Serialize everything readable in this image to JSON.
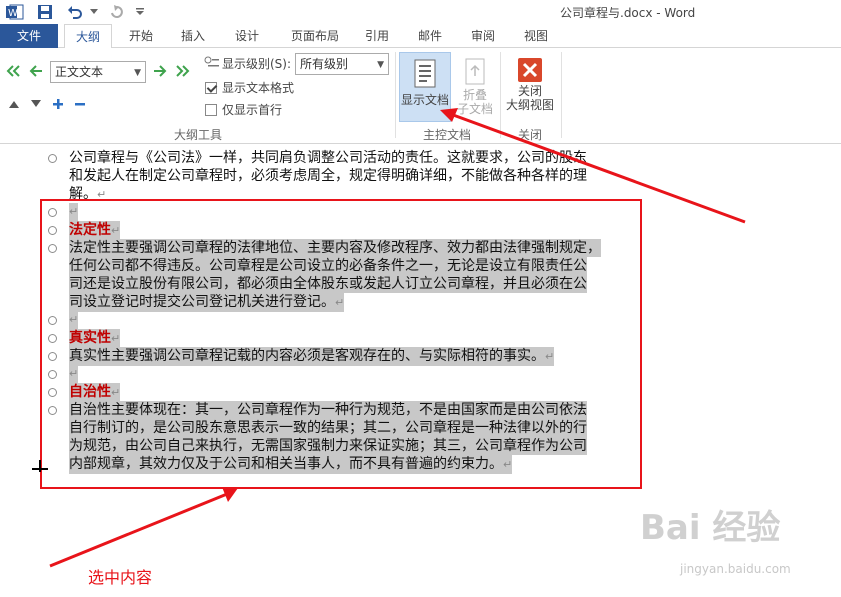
{
  "window": {
    "title": "公司章程与.docx - Word"
  },
  "tabs": [
    "文件",
    "大纲",
    "开始",
    "插入",
    "设计",
    "页面布局",
    "引用",
    "邮件",
    "审阅",
    "视图"
  ],
  "ribbon": {
    "outline_tools": {
      "label": "大纲工具",
      "level_value": "正文文本",
      "show_level_label": "显示级别(S):",
      "show_level_value": "所有级别",
      "show_text_format": "显示文本格式",
      "show_first_line_only": "仅显示首行",
      "show_text_format_checked": true,
      "show_first_line_only_checked": false
    },
    "master_document": {
      "label": "主控文档",
      "show_document": "显示文档",
      "collapse_line1": "折叠",
      "collapse_line2": "子文档"
    },
    "close": {
      "label": "关闭",
      "close_line1": "关闭",
      "close_line2": "大纲视图"
    }
  },
  "document": {
    "intro": [
      "公司章程与《公司法》一样，共同肩负调整公司活动的责任。这就要求，公司的股东",
      "和发起人在制定公司章程时，必须考虑周全，规定得明确详细，不能做各种各样的理",
      "解。"
    ],
    "legal_heading": "法定性",
    "legal_body": [
      "法定性主要强调公司章程的法律地位、主要内容及修改程序、效力都由法律强制规定，",
      "任何公司都不得违反。公司章程是公司设立的必备条件之一，无论是设立有限责任公",
      "司还是设立股份有限公司，都必须由全体股东或发起人订立公司章程，并且必须在公",
      "司设立登记时提交公司登记机关进行登记。"
    ],
    "truth_heading": "真实性",
    "truth_body": "真实性主要强调公司章程记载的内容必须是客观存在的、与实际相符的事实。",
    "self_heading": "自治性",
    "self_body": [
      "自治性主要体现在：其一，公司章程作为一种行为规范，不是由国家而是由公司依法",
      "自行制订的，是公司股东意思表示一致的结果；其二，公司章程是一种法律以外的行",
      "为规范，由公司自己来执行，无需国家强制力来保证实施；其三，公司章程作为公司",
      "内部规章，其效力仅及于公司和相关当事人，而不具有普遍的约束力。"
    ],
    "paragraph_mark": "↵"
  },
  "annotation": {
    "text": "选中内容"
  },
  "watermark": {
    "text": "Bai 经验",
    "sub": "jingyan.baidu.com"
  },
  "colors": {
    "file_tab": "#2b579a",
    "heading": "#c00000",
    "annotation": "#e8141a",
    "selection": "#c8c8c8"
  }
}
